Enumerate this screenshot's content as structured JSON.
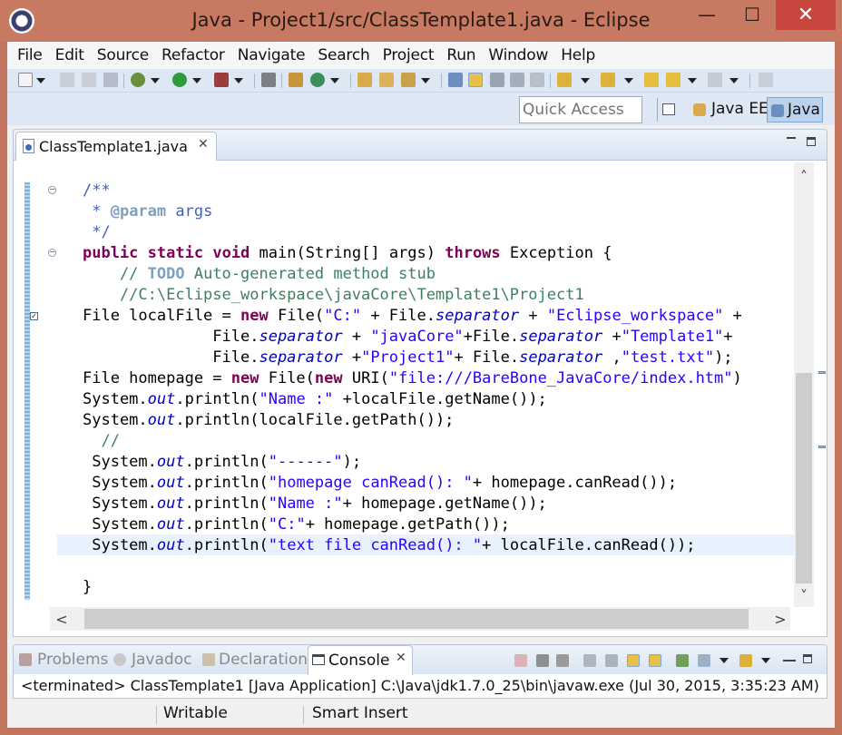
{
  "window": {
    "title": "Java - Project1/src/ClassTemplate1.java - Eclipse",
    "minimize_glyph": "—",
    "maximize_glyph": "☐",
    "close_glyph": "✕"
  },
  "menu": [
    "File",
    "Edit",
    "Source",
    "Refactor",
    "Navigate",
    "Search",
    "Project",
    "Run",
    "Window",
    "Help"
  ],
  "perspective_bar": {
    "quick_access_placeholder": "Quick Access",
    "perspectives": [
      {
        "label": "Java EE",
        "active": false
      },
      {
        "label": "Java",
        "active": true
      }
    ]
  },
  "editor": {
    "tab_label": "ClassTemplate1.java",
    "tab_close_glyph": "✕",
    "code_lines": [
      [
        [
          "jd",
          "/**"
        ]
      ],
      [
        [
          "jd",
          " * "
        ],
        [
          "tag",
          "@param"
        ],
        [
          "jd",
          " args"
        ]
      ],
      [
        [
          "jd",
          " */"
        ]
      ],
      [
        [
          "kw",
          "public"
        ],
        [
          "",
          " "
        ],
        [
          "kw",
          "static"
        ],
        [
          "",
          " "
        ],
        [
          "kw",
          "void"
        ],
        [
          "",
          " main(String[] args) "
        ],
        [
          "kw",
          "throws"
        ],
        [
          "",
          " Exception {"
        ]
      ],
      [
        [
          "cm",
          "    // "
        ],
        [
          "todo",
          "TODO"
        ],
        [
          "cm",
          " Auto-generated method stub"
        ]
      ],
      [
        [
          "cm",
          "    //C:\\Eclipse_workspace\\javaCore\\Template1\\Project1"
        ]
      ],
      [
        [
          "",
          "File localFile = "
        ],
        [
          "kw",
          "new"
        ],
        [
          "",
          " File("
        ],
        [
          "st",
          "\"C:\""
        ],
        [
          "",
          " + File."
        ],
        [
          "fi",
          "separator"
        ],
        [
          "",
          " + "
        ],
        [
          "st",
          "\"Eclipse_workspace\""
        ],
        [
          "",
          " +"
        ]
      ],
      [
        [
          "",
          "              File."
        ],
        [
          "fi",
          "separator"
        ],
        [
          "",
          " + "
        ],
        [
          "st",
          "\"javaCore\""
        ],
        [
          "",
          "+File."
        ],
        [
          "fi",
          "separator"
        ],
        [
          "",
          " +"
        ],
        [
          "st",
          "\"Template1\""
        ],
        [
          "",
          "+"
        ]
      ],
      [
        [
          "",
          "              File."
        ],
        [
          "fi",
          "separator"
        ],
        [
          "",
          " +"
        ],
        [
          "st",
          "\"Project1\""
        ],
        [
          "",
          "+ File."
        ],
        [
          "fi",
          "separator"
        ],
        [
          "",
          " ,"
        ],
        [
          "st",
          "\"test.txt\""
        ],
        [
          "",
          ");"
        ]
      ],
      [
        [
          "",
          "File homepage = "
        ],
        [
          "kw",
          "new"
        ],
        [
          "",
          " File("
        ],
        [
          "kw",
          "new"
        ],
        [
          "",
          " URI("
        ],
        [
          "st",
          "\"file:///BareBone_JavaCore/index.htm\""
        ],
        [
          "",
          ")"
        ]
      ],
      [
        [
          "",
          "System."
        ],
        [
          "fi",
          "out"
        ],
        [
          "",
          ".println("
        ],
        [
          "st",
          "\"Name :\""
        ],
        [
          "",
          " +localFile.getName());"
        ]
      ],
      [
        [
          "",
          "System."
        ],
        [
          "fi",
          "out"
        ],
        [
          "",
          ".println(localFile.getPath());"
        ]
      ],
      [
        [
          "cm",
          "  //"
        ]
      ],
      [
        [
          "",
          " System."
        ],
        [
          "fi",
          "out"
        ],
        [
          "",
          ".println("
        ],
        [
          "st",
          "\"------\""
        ],
        [
          "",
          ");"
        ]
      ],
      [
        [
          "",
          " System."
        ],
        [
          "fi",
          "out"
        ],
        [
          "",
          ".println("
        ],
        [
          "st",
          "\"homepage canRead(): \""
        ],
        [
          "",
          "+ homepage.canRead());"
        ]
      ],
      [
        [
          "",
          " System."
        ],
        [
          "fi",
          "out"
        ],
        [
          "",
          ".println("
        ],
        [
          "st",
          "\"Name :\""
        ],
        [
          "",
          "+ homepage.getName());"
        ]
      ],
      [
        [
          "",
          " System."
        ],
        [
          "fi",
          "out"
        ],
        [
          "",
          ".println("
        ],
        [
          "st",
          "\"C:\""
        ],
        [
          "",
          "+ homepage.getPath());"
        ]
      ],
      [
        [
          "",
          " System."
        ],
        [
          "fi",
          "out"
        ],
        [
          "",
          ".println("
        ],
        [
          "st",
          "\"text file canRead(): \""
        ],
        [
          "",
          "+ localFile.canRead());"
        ]
      ],
      [
        [
          "",
          ""
        ]
      ],
      [
        [
          "",
          "}"
        ]
      ]
    ],
    "scroll_up_glyph": "˄",
    "scroll_down_glyph": "˅",
    "scroll_left_glyph": "<",
    "scroll_right_glyph": ">"
  },
  "bottom_panel": {
    "tabs": [
      {
        "label": "Problems",
        "icon": "problems-icon"
      },
      {
        "label": "Javadoc",
        "icon": "javadoc-icon"
      },
      {
        "label": "Declaration",
        "icon": "declaration-icon"
      }
    ],
    "console_tab": "Console",
    "console_close_glyph": "✕",
    "console_output": "<terminated> ClassTemplate1 [Java Application] C:\\Java\\jdk1.7.0_25\\bin\\javaw.exe (Jul 30, 2015, 3:35:23 AM)"
  },
  "status_bar": {
    "writable": "Writable",
    "insert_mode": "Smart Insert"
  },
  "colors": {
    "title_bar": "#c77a61",
    "close_button": "#c7463e",
    "keyword": "#7f0055",
    "comment": "#3f7f5f",
    "javadoc": "#3f5fbf",
    "string": "#2a00ff",
    "field": "#0000c0",
    "current_line": "#e8f2fe"
  }
}
